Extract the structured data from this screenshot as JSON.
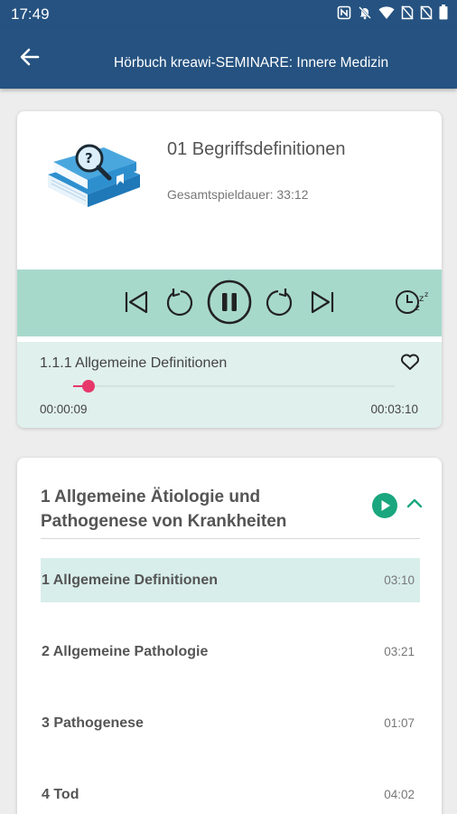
{
  "status_bar": {
    "time": "17:49",
    "icons": [
      "nfc-icon",
      "mute-icon",
      "wifi-icon",
      "no-sim-icon",
      "no-sim-icon",
      "battery-icon"
    ]
  },
  "app_bar": {
    "back_icon": "arrow-back-icon",
    "title": "Hörbuch kreawi-SEMINARE: Innere Medizin"
  },
  "player": {
    "cover_icon": "book-magnifier-icon",
    "track_title": "01 Begriffsdefinitionen",
    "total_duration": "Gesamtspieldauer: 33:12",
    "controls": [
      "skip-previous-icon",
      "replay-icon",
      "pause-icon",
      "forward-icon",
      "skip-next-icon",
      "sleep-timer-icon"
    ],
    "chapter": "1.1.1 Allgemeine Definitionen",
    "favorite_icon": "heart-outline-icon",
    "current_time": "00:00:09",
    "total_time": "00:03:10",
    "progress": 0.047,
    "colors": {
      "controls_bg": "#a7d9cb",
      "progress_bg": "#e0f0ed",
      "accent": "#e6386b"
    }
  },
  "section": {
    "title": "1 Allgemeine Ätiologie und Pathogenese von Krankheiten",
    "play_icon": "play-circle-icon",
    "collapse_icon": "chevron-up-icon",
    "accent_color": "#1aa67e",
    "chapters": [
      {
        "label": "1 Allgemeine Definitionen",
        "duration": "03:10",
        "active": true
      },
      {
        "label": "2 Allgemeine Pathologie",
        "duration": "03:21",
        "active": false
      },
      {
        "label": "3 Pathogenese",
        "duration": "01:07",
        "active": false
      },
      {
        "label": "4 Tod",
        "duration": "04:02",
        "active": false
      }
    ]
  }
}
